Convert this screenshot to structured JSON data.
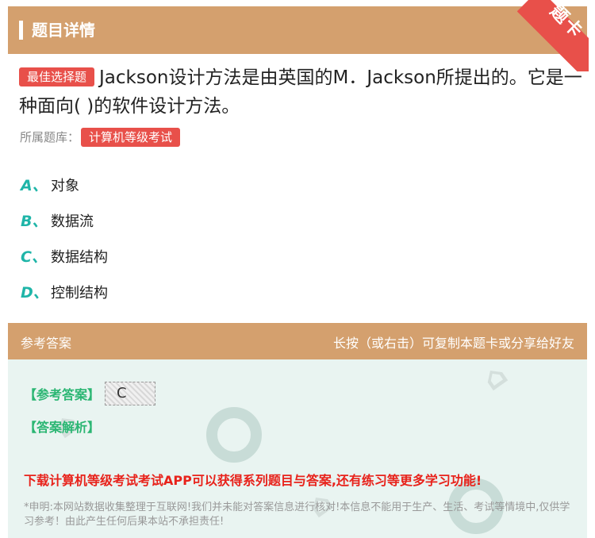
{
  "header": {
    "title": "题目详情",
    "corner_label": "题卡"
  },
  "question": {
    "badge": "最佳选择题",
    "text": "Jackson设计方法是由英国的M．Jackson所提出的。它是一种面向( )的软件设计方法。",
    "bank_label": "所属题库：",
    "bank_name": "计算机等级考试"
  },
  "options": [
    {
      "letter": "A、",
      "text": "对象"
    },
    {
      "letter": "B、",
      "text": "数据流"
    },
    {
      "letter": "C、",
      "text": "数据结构"
    },
    {
      "letter": "D、",
      "text": "控制结构"
    }
  ],
  "answer_header": {
    "left": "参考答案",
    "right": "长按（或右击）可复制本题卡或分享给好友"
  },
  "answer": {
    "ref_label": "【参考答案】",
    "ref_value": "C",
    "analysis_label": "【答案解析】",
    "promo": "下载计算机等级考试考试APP可以获得系列题目与答案,还有练习等更多学习功能!",
    "disclaimer": "*申明:本网站数据收集整理于互联网!我们并未能对答案信息进行核对!本信息不能用于生产、生活、考试等情境中,仅供学习参考！由此产生任何后果本站不承担责任!"
  },
  "colors": {
    "header": "#d4a06e",
    "accent_red": "#e8504a",
    "option_letter": "#1fb5a8",
    "answer_bg": "#e9f4f1"
  }
}
